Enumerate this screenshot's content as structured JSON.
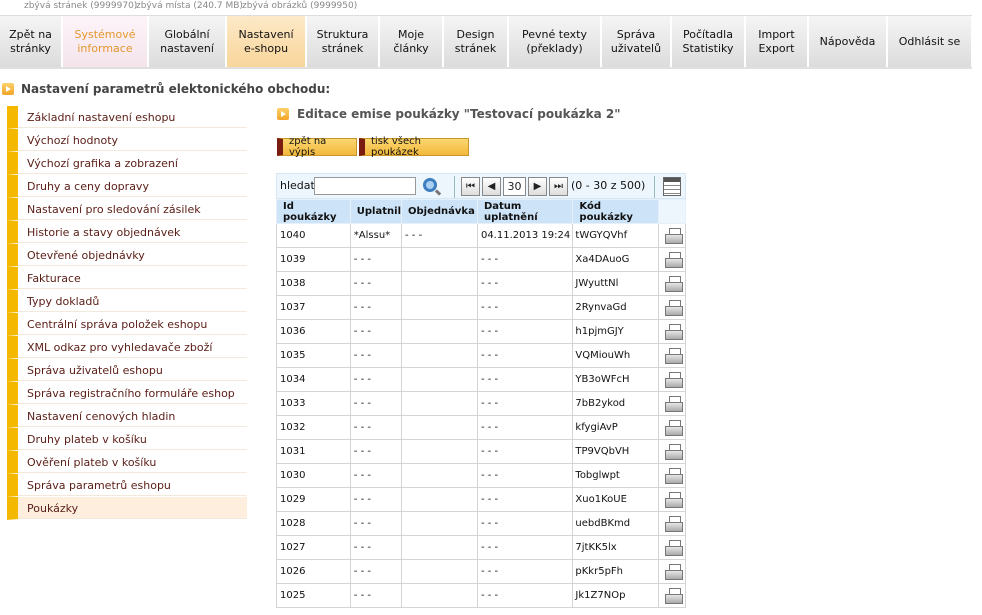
{
  "status": {
    "pages_left": "zbývá stránek (9999970)",
    "space_left": "zbývá místa (240.7 MB)",
    "images_left": "zbývá obrázků (9999950)"
  },
  "nav": {
    "tabs": [
      {
        "label": "Zpět na\nstránky"
      },
      {
        "label": "Systémové\ninformace"
      },
      {
        "label": "Globální\nnastavení"
      },
      {
        "label": "Nastavení\ne-shopu"
      },
      {
        "label": "Struktura\nstránek"
      },
      {
        "label": "Moje\nčlánky"
      },
      {
        "label": "Design\nstránek"
      },
      {
        "label": "Pevné texty\n(překlady)"
      },
      {
        "label": "Správa\nuživatelů"
      },
      {
        "label": "Počítadla\nStatistiky"
      },
      {
        "label": "Import\nExport"
      },
      {
        "label": "Nápověda"
      },
      {
        "label": "Odhlásit se"
      }
    ]
  },
  "section_title": "Nastavení parametrů elektonického obchodu:",
  "sidebar": {
    "items": [
      {
        "label": "Základní nastavení eshopu"
      },
      {
        "label": "Výchozí hodnoty"
      },
      {
        "label": "Výchozí grafika a zobrazení"
      },
      {
        "label": "Druhy a ceny dopravy"
      },
      {
        "label": "Nastavení pro sledování zásilek"
      },
      {
        "label": "Historie a stavy objednávek"
      },
      {
        "label": "Otevřené objednávky"
      },
      {
        "label": "Fakturace"
      },
      {
        "label": "Typy dokladů"
      },
      {
        "label": "Centrální správa položek eshopu"
      },
      {
        "label": "XML odkaz pro vyhledavače zboží"
      },
      {
        "label": "Správa uživatelů eshopu"
      },
      {
        "label": "Správa registračního formuláře eshop"
      },
      {
        "label": "Nastavení cenových hladin"
      },
      {
        "label": "Druhy plateb v košíku"
      },
      {
        "label": "Ověření plateb v košíku"
      },
      {
        "label": "Správa parametrů eshopu"
      },
      {
        "label": "Poukázky"
      }
    ]
  },
  "edit_title": "Editace emise poukázky \"Testovací poukázka 2\"",
  "buttons": {
    "back": "zpět na výpis",
    "print_all": "tisk všech poukázek"
  },
  "toolbar": {
    "search_label": "hledat:",
    "search_value": "",
    "first": "⏮",
    "prev": "◀",
    "page": "30",
    "next": "▶",
    "last": "⏭",
    "range": "(0 - 30 z 500)"
  },
  "table": {
    "headers": [
      "Id poukázky",
      "Uplatnil",
      "Objednávka",
      "Datum uplatnění",
      "Kód poukázky"
    ],
    "rows": [
      [
        "1040",
        "*Alssu*",
        "- - -",
        "04.11.2013 19:24",
        "tWGYQVhf"
      ],
      [
        "1039",
        "- - -",
        "",
        "- - -",
        "Xa4DAuoG"
      ],
      [
        "1038",
        "- - -",
        "",
        "- - -",
        "JWyuttNl"
      ],
      [
        "1037",
        "- - -",
        "",
        "- - -",
        "2RynvaGd"
      ],
      [
        "1036",
        "- - -",
        "",
        "- - -",
        "h1pjmGJY"
      ],
      [
        "1035",
        "- - -",
        "",
        "- - -",
        "VQMiouWh"
      ],
      [
        "1034",
        "- - -",
        "",
        "- - -",
        "YB3oWFcH"
      ],
      [
        "1033",
        "- - -",
        "",
        "- - -",
        "7bB2ykod"
      ],
      [
        "1032",
        "- - -",
        "",
        "- - -",
        "kfygiAvP"
      ],
      [
        "1031",
        "- - -",
        "",
        "- - -",
        "TP9VQbVH"
      ],
      [
        "1030",
        "- - -",
        "",
        "- - -",
        "Tobglwpt"
      ],
      [
        "1029",
        "- - -",
        "",
        "- - -",
        "Xuo1KoUE"
      ],
      [
        "1028",
        "- - -",
        "",
        "- - -",
        "uebdBKmd"
      ],
      [
        "1027",
        "- - -",
        "",
        "- - -",
        "7jtKK5lx"
      ],
      [
        "1026",
        "- - -",
        "",
        "- - -",
        "pKkr5pFh"
      ],
      [
        "1025",
        "- - -",
        "",
        "- - -",
        "Jk1Z7NOp"
      ]
    ]
  },
  "colors": {
    "sidebar_accent": "#f5b800",
    "header_bg": "#cce3f8",
    "button_bg": "#f2b83a",
    "active_tab": "#f9d59a"
  }
}
